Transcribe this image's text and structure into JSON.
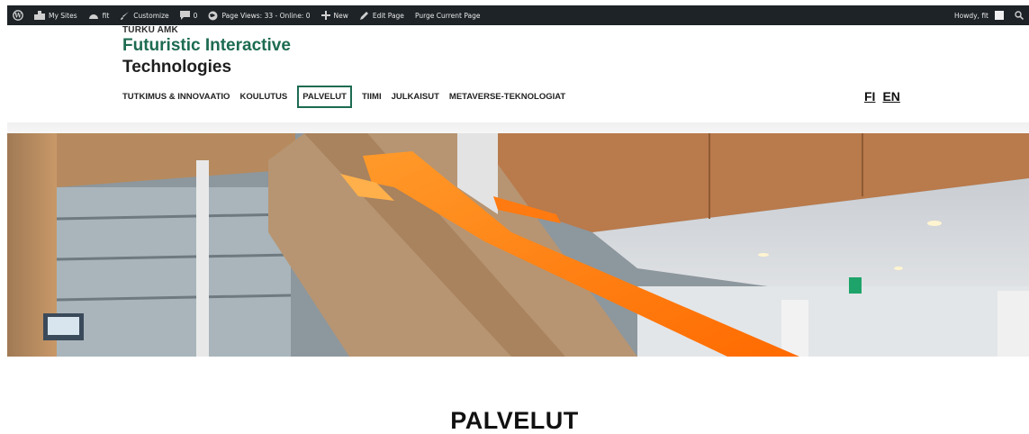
{
  "adminbar": {
    "wp_icon": "wordpress-logo-icon",
    "my_sites": "My Sites",
    "site": "fit",
    "customize": "Customize",
    "comments_count": "0",
    "page_views": "Page Views: 33 - Online: 0",
    "new": "New",
    "edit_page": "Edit Page",
    "purge": "Purge Current Page",
    "howdy": "Howdy, fit"
  },
  "header": {
    "org": "TURKU AMK",
    "title_line1": "Futuristic Interactive",
    "title_line2": "Technologies",
    "brand_color": "#1d6b52"
  },
  "nav": {
    "items": [
      {
        "label": "TUTKIMUS & INNOVAATIO"
      },
      {
        "label": "KOULUTUS"
      },
      {
        "label": "PALVELUT",
        "active": true
      },
      {
        "label": "TIIMI"
      },
      {
        "label": "JULKAISUT"
      },
      {
        "label": "METAVERSE-TEKNOLOGIAT"
      }
    ]
  },
  "languages": [
    "FI",
    "EN"
  ],
  "main": {
    "page_title": "PALVELUT"
  }
}
